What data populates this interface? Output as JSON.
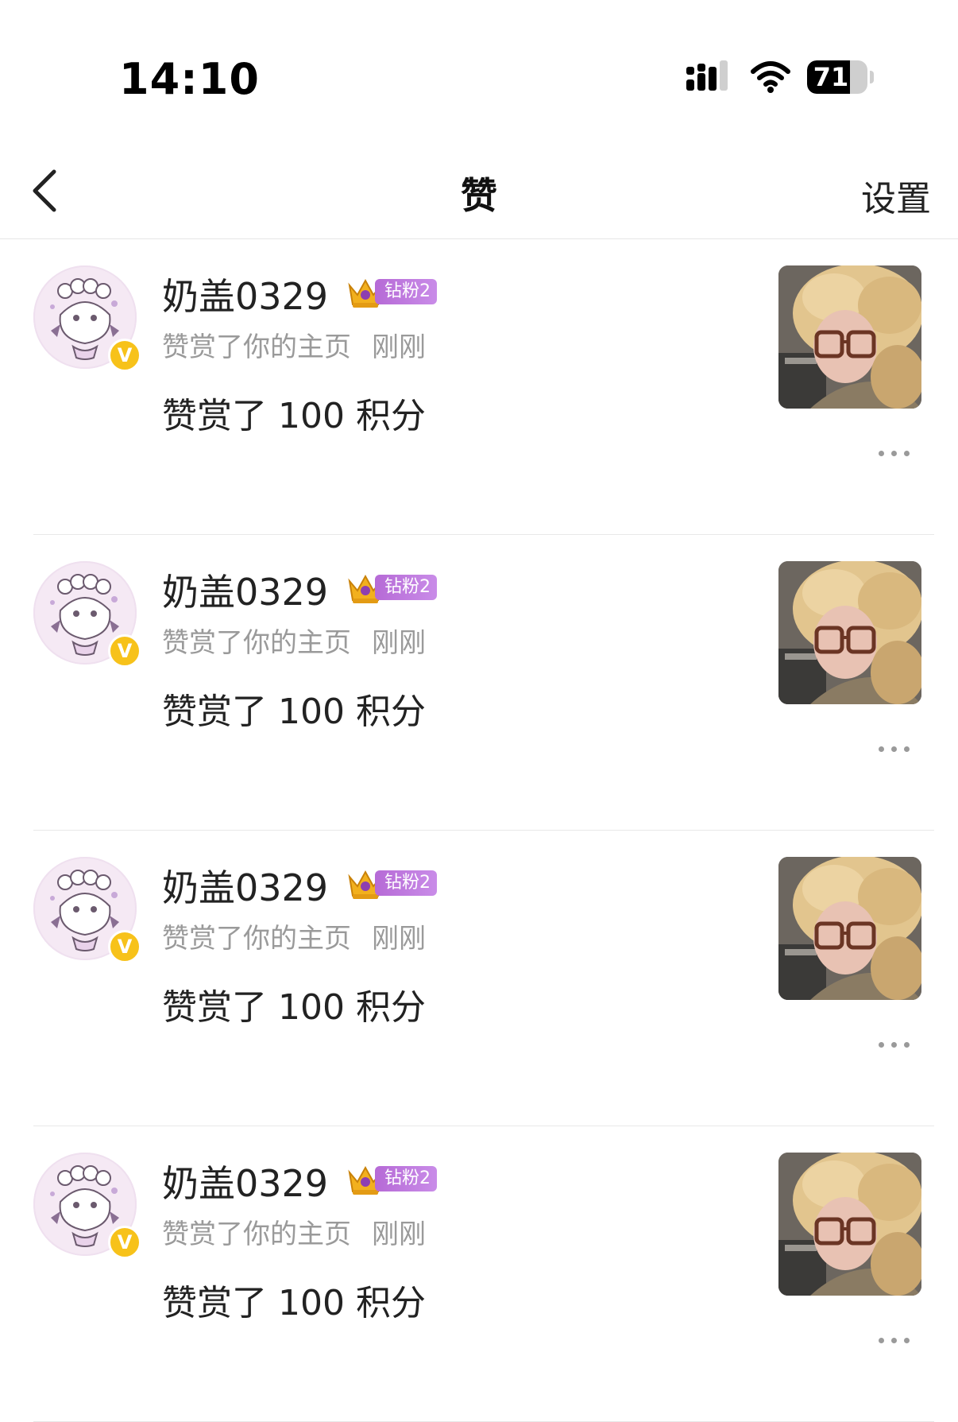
{
  "status_bar": {
    "time": "14:10",
    "battery": "71",
    "battery_level": 0.71,
    "icons": [
      "signal-icon",
      "wifi-icon",
      "battery-icon"
    ]
  },
  "nav": {
    "back_icon": "chevron-left-icon",
    "title": "赞",
    "settings_label": "设置"
  },
  "colors": {
    "fan_badge": "#b66ad6",
    "verified": "#f7c21a",
    "subtitle_gray": "#9a9a9a"
  },
  "items": [
    {
      "username": "奶盖0329",
      "fan_badge": "钻粉2",
      "action": "赞赏了你的主页",
      "time": "刚刚",
      "content": "赞赏了 100 积分",
      "verified_mark": "V"
    },
    {
      "username": "奶盖0329",
      "fan_badge": "钻粉2",
      "action": "赞赏了你的主页",
      "time": "刚刚",
      "content": "赞赏了 100 积分",
      "verified_mark": "V"
    },
    {
      "username": "奶盖0329",
      "fan_badge": "钻粉2",
      "action": "赞赏了你的主页",
      "time": "刚刚",
      "content": "赞赏了 100 积分",
      "verified_mark": "V"
    },
    {
      "username": "奶盖0329",
      "fan_badge": "钻粉2",
      "action": "赞赏了你的主页",
      "time": "刚刚",
      "content": "赞赏了 100 积分",
      "verified_mark": "V"
    }
  ]
}
